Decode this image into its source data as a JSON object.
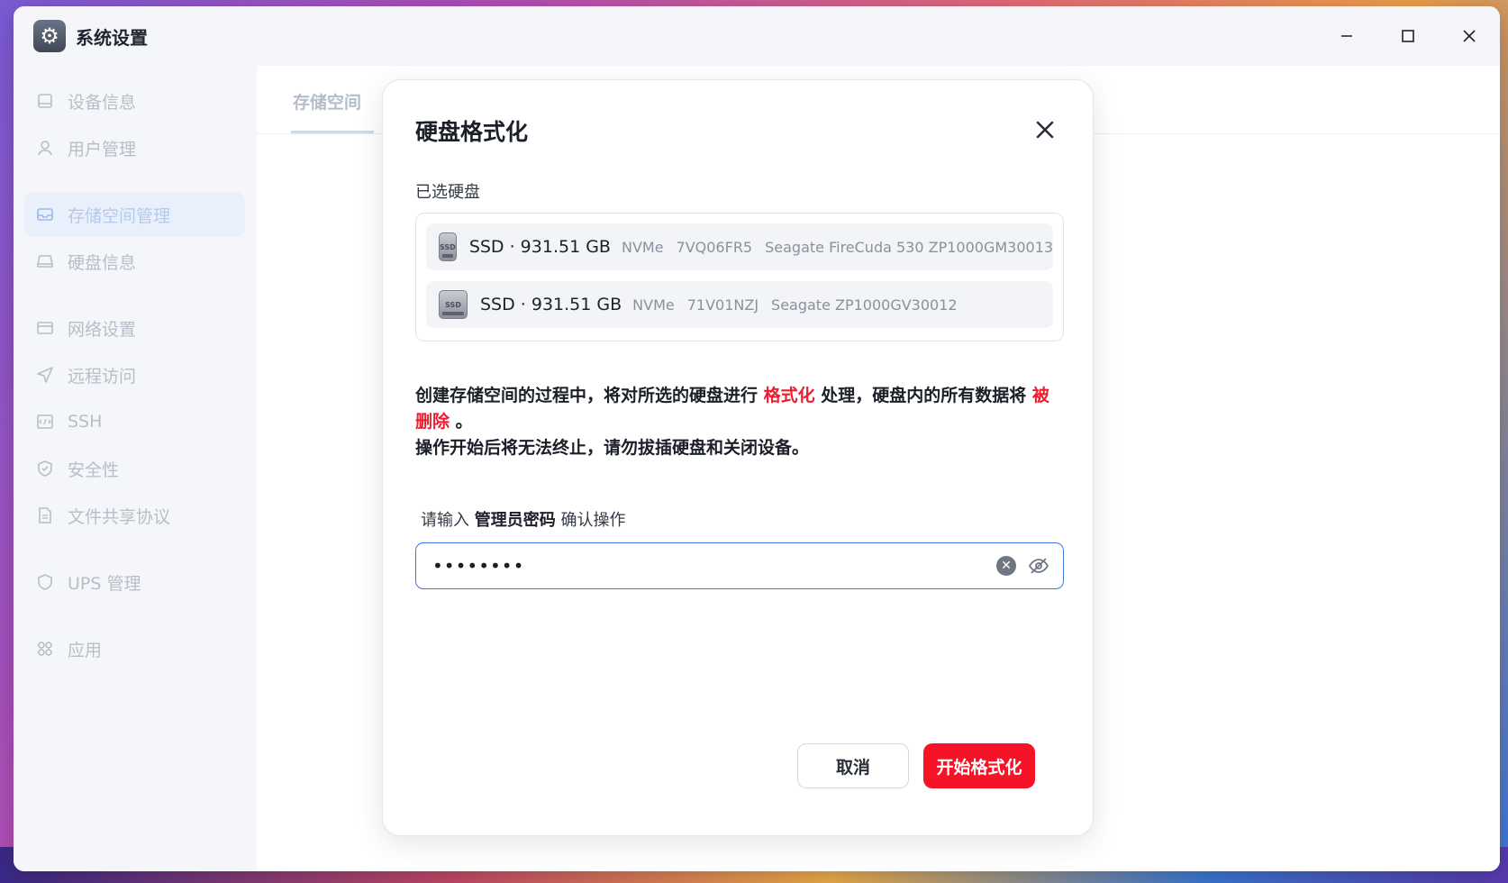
{
  "window": {
    "title": "系统设置",
    "controls": {
      "minimize": "—",
      "maximize": "☐",
      "close": "✕"
    }
  },
  "sidebar": {
    "items": [
      {
        "label": "设备信息",
        "icon": "device-icon",
        "active": false
      },
      {
        "label": "用户管理",
        "icon": "user-icon",
        "active": false
      },
      {
        "label": "存储空间管理",
        "icon": "storage-icon",
        "active": true
      },
      {
        "label": "硬盘信息",
        "icon": "disk-icon",
        "active": false
      },
      {
        "label": "网络设置",
        "icon": "network-icon",
        "active": false
      },
      {
        "label": "远程访问",
        "icon": "remote-icon",
        "active": false
      },
      {
        "label": "SSH",
        "icon": "ssh-icon",
        "active": false
      },
      {
        "label": "安全性",
        "icon": "shield-icon",
        "active": false
      },
      {
        "label": "文件共享协议",
        "icon": "file-share-icon",
        "active": false
      },
      {
        "label": "UPS 管理",
        "icon": "ups-icon",
        "active": false
      },
      {
        "label": "应用",
        "icon": "apps-icon",
        "active": false
      }
    ]
  },
  "content": {
    "tab": "存储空间"
  },
  "modal": {
    "title": "硬盘格式化",
    "close_symbol": "✕",
    "selected_label": "已选硬盘",
    "disks": [
      {
        "icon_text": "SSD",
        "main": "SSD · 931.51 GB",
        "interface": "NVMe",
        "serial": "7VQ06FR5",
        "model": "Seagate FireCuda 530 ZP1000GM30013"
      },
      {
        "icon_text": "SSD",
        "main": "SSD · 931.51 GB",
        "interface": "NVMe",
        "serial": "71V01NZJ",
        "model": "Seagate ZP1000GV30012"
      }
    ],
    "warning": {
      "part1": "创建存储空间的过程中，将对所选的硬盘进行 ",
      "highlight1": "格式化",
      "part2": " 处理，硬盘内的所有数据将 ",
      "highlight2": "被删除",
      "part3": " 。",
      "line2": "操作开始后将无法终止，请勿拔插硬盘和关闭设备。"
    },
    "password_prompt": {
      "prefix": "请输入 ",
      "bold": "管理员密码",
      "suffix": " 确认操作"
    },
    "password_value": "••••••••",
    "clear_symbol": "✕",
    "cancel_label": "取消",
    "format_label": "开始格式化"
  },
  "colors": {
    "accent": "#3d77e0",
    "danger": "#f51427"
  }
}
